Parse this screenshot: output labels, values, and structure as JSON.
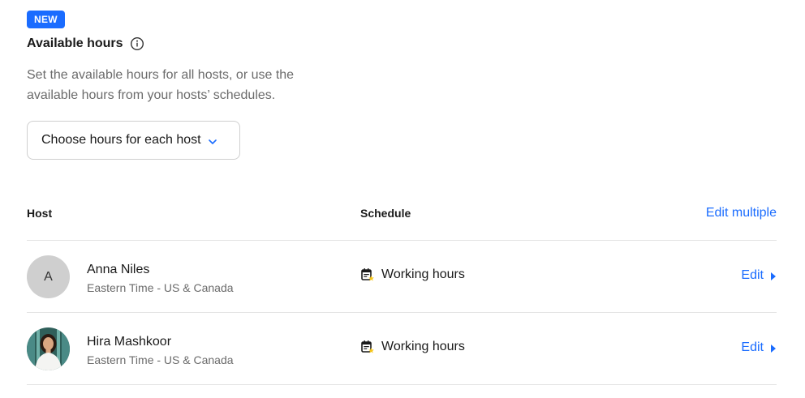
{
  "badge": "NEW",
  "section": {
    "title": "Available hours",
    "description": "Set the available hours for all hosts, or use the available hours from your hosts’ schedules.",
    "select_value": "Choose hours for each host"
  },
  "table": {
    "col_host": "Host",
    "col_schedule": "Schedule",
    "edit_multiple": "Edit multiple",
    "rows": [
      {
        "initial": "A",
        "name": "Anna Niles",
        "timezone": "Eastern Time - US & Canada",
        "schedule": "Working hours",
        "edit": "Edit"
      },
      {
        "name": "Hira Mashkoor",
        "timezone": "Eastern Time - US & Canada",
        "schedule": "Working hours",
        "edit": "Edit"
      }
    ]
  },
  "colors": {
    "accent": "#1a6cff",
    "muted_text": "#6b6b6b",
    "border": "#cfcfcf",
    "star": "#f5c518"
  },
  "icons": {
    "info": "info-icon",
    "chevron": "chevron-down-icon",
    "calendar": "calendar-star-icon",
    "caret": "caret-right-icon"
  }
}
